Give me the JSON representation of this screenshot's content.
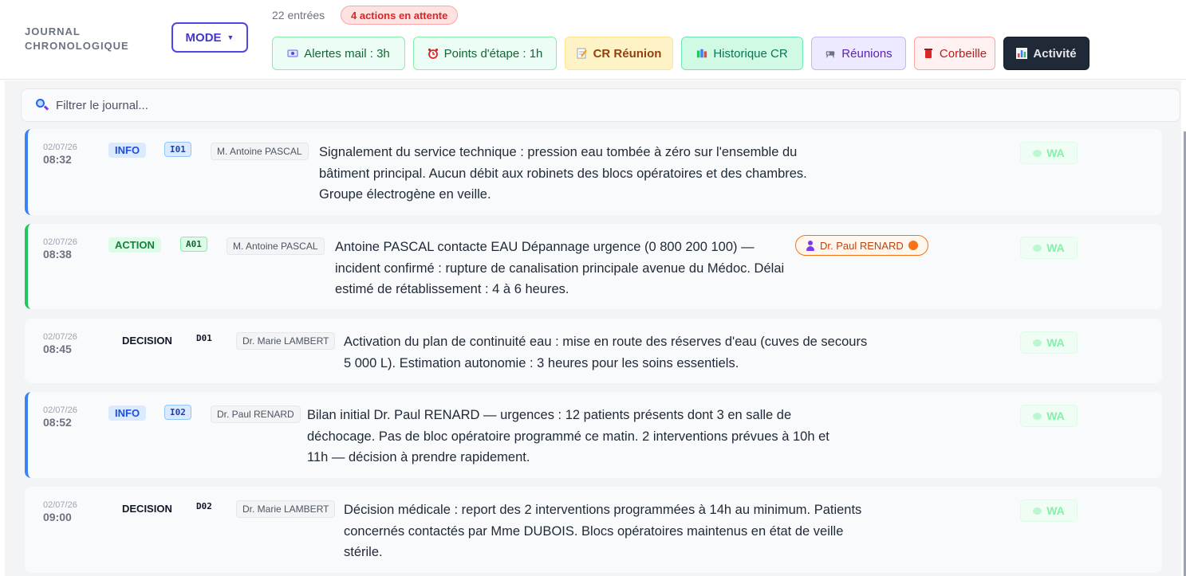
{
  "header": {
    "title": "JOURNAL\nCHRONOLOGIQUE",
    "mode_label": "MODE",
    "entry_count": "22 entrées",
    "pending_badge": "4 actions en attente"
  },
  "toolbar": [
    {
      "label": "Alertes mail : 3h",
      "icon": "email-icon"
    },
    {
      "label": "Points d'étape : 1h",
      "icon": "alarm-clock-icon"
    },
    {
      "label": "CR Réunion",
      "icon": "memo-icon"
    },
    {
      "label": "Historique CR",
      "icon": "books-icon"
    },
    {
      "label": "Réunions",
      "icon": "projector-icon"
    },
    {
      "label": "Corbeille",
      "icon": "trash-icon"
    },
    {
      "label": "Activité",
      "icon": "bar-chart-icon"
    }
  ],
  "search": {
    "placeholder": "Filtrer le journal..."
  },
  "entries": [
    {
      "date": "02/07/26",
      "time": "08:32",
      "type": "INFO",
      "code": "I01",
      "author": "M. Antoine PASCAL",
      "text": "Signalement du service technique : pression eau tombée à zéro sur l'ensemble du bâtiment principal. Aucun débit aux robinets des blocs opératoires et des chambres. Groupe électrogène en veille.",
      "wa": "WA"
    },
    {
      "date": "02/07/26",
      "time": "08:38",
      "type": "ACTION",
      "code": "A01",
      "author": "M. Antoine PASCAL",
      "text": "Antoine PASCAL contacte EAU Dépannage urgence (0 800 200 100) — incident confirmé : rupture de canalisation principale avenue du Médoc. Délai estimé de rétablissement : 4 à 6 heures.",
      "assignee": "Dr. Paul RENARD",
      "wa": "WA"
    },
    {
      "date": "02/07/26",
      "time": "08:45",
      "type": "DECISION",
      "code": "D01",
      "author": "Dr. Marie LAMBERT",
      "text": "Activation du plan de continuité eau : mise en route des réserves d'eau (cuves de secours 5 000 L). Estimation autonomie : 3 heures pour les soins essentiels.",
      "wa": "WA"
    },
    {
      "date": "02/07/26",
      "time": "08:52",
      "type": "INFO",
      "code": "I02",
      "author": "Dr. Paul RENARD",
      "text": "Bilan initial Dr. Paul RENARD — urgences : 12 patients présents dont 3 en salle de déchocage. Pas de bloc opératoire programmé ce matin. 2 interventions prévues à 10h et 11h — décision à prendre rapidement.",
      "wa": "WA"
    },
    {
      "date": "02/07/26",
      "time": "09:00",
      "type": "DECISION",
      "code": "D02",
      "author": "Dr. Marie LAMBERT",
      "text": "Décision médicale : report des 2 interventions programmées à 14h au minimum. Patients concernés contactés par Mme DUBOIS. Blocs opératoires maintenus en état de veille stérile.",
      "wa": "WA"
    }
  ]
}
